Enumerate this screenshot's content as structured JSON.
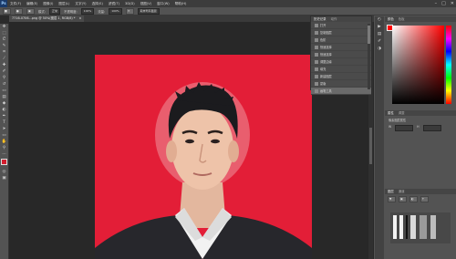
{
  "menubar": {
    "logo": "Ps",
    "items": [
      "文件(F)",
      "编辑(E)",
      "图像(I)",
      "图层(L)",
      "文字(Y)",
      "选择(S)",
      "滤镜(T)",
      "3D(D)",
      "视图(V)",
      "窗口(W)",
      "帮助(H)"
    ],
    "window_controls": [
      "–",
      "□",
      "✕"
    ]
  },
  "options": {
    "mode_label": "模式:",
    "mode_value": "正常",
    "opacity_label": "不透明度:",
    "opacity_value": "100%",
    "flow_label": "流量:",
    "flow_value": "100%",
    "sample_button": "取样所有图层"
  },
  "document": {
    "tab_title": "7716-0706...png @ 50%(图层 1, RGB/8) *",
    "tab_close": "×"
  },
  "history": {
    "title": "历史记录",
    "tab2": "动作",
    "items": [
      "打开",
      "复制图层",
      "色阶",
      "快速选择",
      "快速选择",
      "调整边缘",
      "填充",
      "新建图层",
      "蒙版",
      "画笔工具",
      "合并图层",
      "裁剪",
      "存储"
    ]
  },
  "panels": {
    "color_title": "颜色",
    "color_tab2": "色板",
    "props_title": "属性",
    "props_tab2": "调整",
    "props_item": "像素图层属性",
    "props_w_label": "W",
    "props_h_label": "H",
    "layers_title": "图层",
    "layers_tab2": "通道"
  },
  "colors": {
    "background_red": "#e31e37",
    "foreground": "#ff0000"
  }
}
